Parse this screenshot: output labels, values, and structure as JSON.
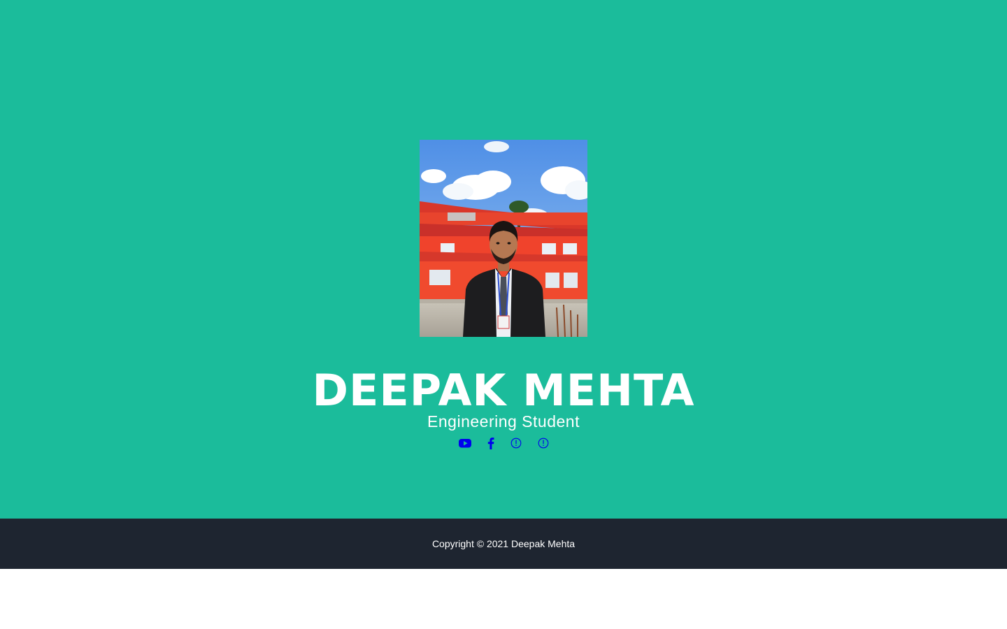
{
  "profile": {
    "name": "DEEPAK MEHTA",
    "tagline": "Engineering Student",
    "photo_alt": "Deepak Mehta"
  },
  "social": [
    {
      "icon": "youtube-icon"
    },
    {
      "icon": "facebook-icon"
    },
    {
      "icon": "missing-icon"
    },
    {
      "icon": "missing-icon"
    }
  ],
  "footer": {
    "copyright": "Copyright © 2021 Deepak Mehta"
  },
  "colors": {
    "hero_bg": "#1bbc9b",
    "footer_bg": "#1e2530",
    "link": "#0000ee",
    "text": "#ffffff"
  }
}
